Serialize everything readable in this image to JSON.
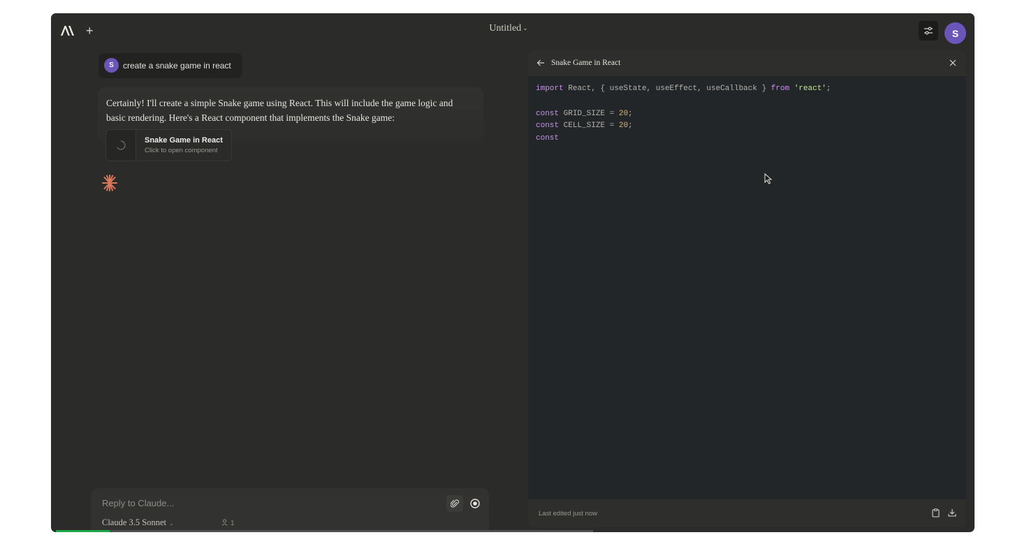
{
  "app": {
    "doc_title": "Untitled",
    "avatar_initial": "S"
  },
  "chat": {
    "user_message": "create a snake game in react",
    "user_initial": "S",
    "assistant_text": "Certainly! I'll create a simple Snake game using React. This will include the game logic and basic rendering. Here's a React component that implements the Snake game:",
    "artifact_card": {
      "title": "Snake Game in React",
      "subtitle": "Click to open component"
    }
  },
  "composer": {
    "placeholder": "Reply to Claude...",
    "model": "Claude 3.5 Sonnet",
    "users_count": "1",
    "progress": 0.1
  },
  "artifact_panel": {
    "title": "Snake Game in React",
    "code_lines": [
      [
        {
          "t": "import",
          "c": "kw"
        },
        {
          "t": " React, { useState, useEffect, useCallback } ",
          "c": ""
        },
        {
          "t": "from",
          "c": "kw"
        },
        {
          "t": " ",
          "c": ""
        },
        {
          "t": "'react'",
          "c": "str"
        },
        {
          "t": ";",
          "c": ""
        }
      ],
      [],
      [
        {
          "t": "const",
          "c": "kw"
        },
        {
          "t": " GRID_SIZE = ",
          "c": ""
        },
        {
          "t": "20",
          "c": "num"
        },
        {
          "t": ";",
          "c": ""
        }
      ],
      [
        {
          "t": "const",
          "c": "kw"
        },
        {
          "t": " CELL_SIZE = ",
          "c": ""
        },
        {
          "t": "20",
          "c": "num"
        },
        {
          "t": ";",
          "c": ""
        }
      ],
      [
        {
          "t": "const",
          "c": "kw"
        }
      ]
    ],
    "footer_status": "Last edited just now"
  },
  "colors": {
    "accent_purple": "#6a55b8",
    "claude_orange": "#d9775c",
    "progress_green": "#1fa84a"
  },
  "icons": [
    "anthropic-logo-icon",
    "plus-icon",
    "chevron-down-icon",
    "sliders-icon",
    "loading-icon",
    "claude-star-icon",
    "paperclip-icon",
    "record-icon",
    "users-icon",
    "arrow-left-icon",
    "close-icon",
    "clipboard-icon",
    "download-icon",
    "mouse-cursor-icon"
  ]
}
